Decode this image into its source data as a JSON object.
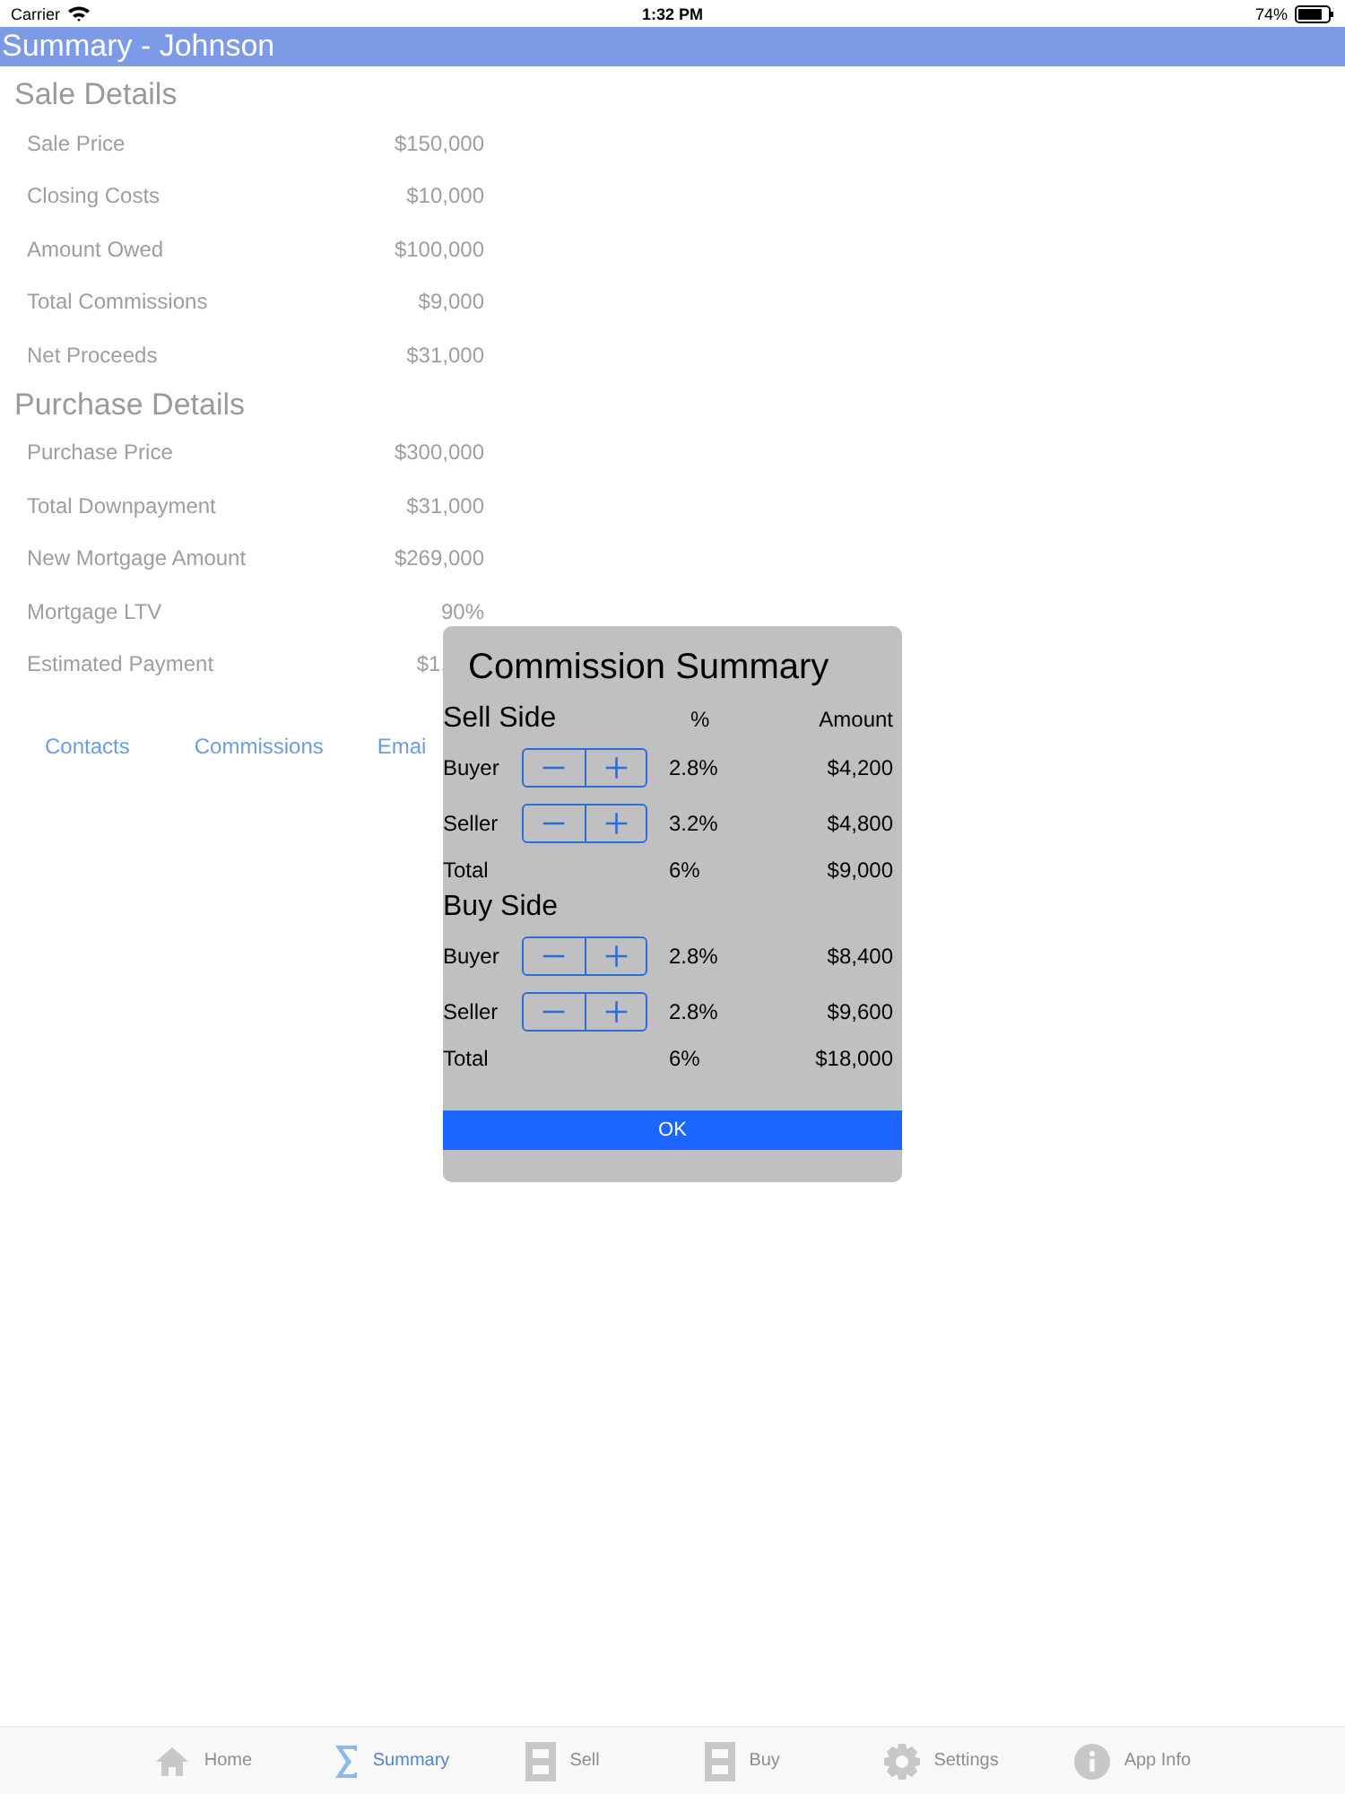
{
  "status_bar": {
    "carrier": "Carrier",
    "time": "1:32 PM",
    "battery": "74%"
  },
  "title": "Summary - Johnson",
  "sections": [
    {
      "heading": "Sale Details",
      "rows": [
        {
          "label": "Sale Price",
          "value": "$150,000"
        },
        {
          "label": "Closing Costs",
          "value": "$10,000"
        },
        {
          "label": "Amount Owed",
          "value": "$100,000"
        },
        {
          "label": "Total Commissions",
          "value": "$9,000"
        },
        {
          "label": "Net Proceeds",
          "value": "$31,000"
        }
      ]
    },
    {
      "heading": "Purchase Details",
      "rows": [
        {
          "label": "Purchase Price",
          "value": "$300,000"
        },
        {
          "label": "Total Downpayment",
          "value": "$31,000"
        },
        {
          "label": "New Mortgage Amount",
          "value": "$269,000"
        },
        {
          "label": "Mortgage LTV",
          "value": "90%"
        },
        {
          "label": "Estimated Payment",
          "value": "$1,"
        }
      ]
    }
  ],
  "links": [
    "Contacts",
    "Commissions",
    "Emai"
  ],
  "dialog": {
    "title": "Commission Summary",
    "percent_header": "%",
    "amount_header": "Amount",
    "groups": [
      {
        "heading": "Sell Side",
        "rows": [
          {
            "kind": "stepper",
            "label": "Buyer",
            "percent": "2.8%",
            "amount": "$4,200"
          },
          {
            "kind": "stepper",
            "label": "Seller",
            "percent": "3.2%",
            "amount": "$4,800"
          },
          {
            "kind": "total",
            "label": "Total",
            "percent": "6%",
            "amount": "$9,000"
          }
        ]
      },
      {
        "heading": "Buy Side",
        "rows": [
          {
            "kind": "stepper",
            "label": "Buyer",
            "percent": "2.8%",
            "amount": "$8,400"
          },
          {
            "kind": "stepper",
            "label": "Seller",
            "percent": "2.8%",
            "amount": "$9,600"
          },
          {
            "kind": "total",
            "label": "Total",
            "percent": "6%",
            "amount": "$18,000"
          }
        ]
      }
    ],
    "button": "OK"
  },
  "tabs": [
    {
      "label": "Home",
      "selected": false
    },
    {
      "label": "Summary",
      "selected": true
    },
    {
      "label": "Sell",
      "selected": false
    },
    {
      "label": "Buy",
      "selected": false
    },
    {
      "label": "Settings",
      "selected": false
    },
    {
      "label": "App Info",
      "selected": false
    }
  ]
}
